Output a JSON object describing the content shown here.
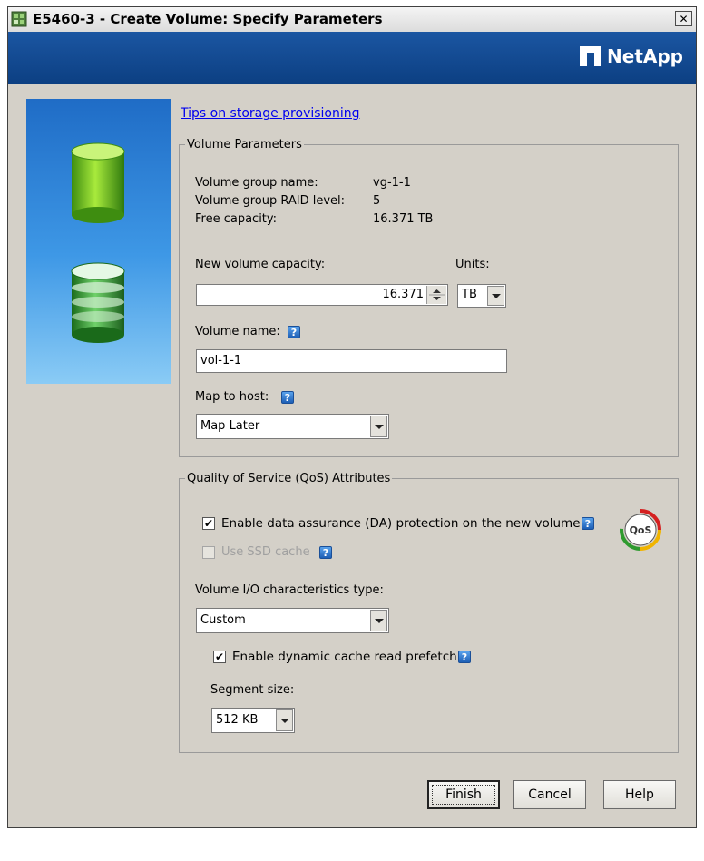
{
  "window": {
    "title": "E5460-3 - Create Volume: Specify Parameters",
    "close_glyph": "✕"
  },
  "banner": {
    "logo_text": "NetApp"
  },
  "tips_link": "Tips on storage provisioning",
  "volume_parameters": {
    "legend": "Volume Parameters",
    "group_name_label": "Volume group name:",
    "group_name_value": "vg-1-1",
    "raid_label": "Volume group RAID level:",
    "raid_value": "5",
    "free_label": "Free capacity:",
    "free_value": "16.371 TB",
    "capacity_label": "New volume capacity:",
    "capacity_value": "16.371",
    "units_label": "Units:",
    "units_value": "TB",
    "name_label": "Volume name:",
    "name_value": "vol-1-1",
    "map_label": "Map to host:",
    "map_value": "Map Later"
  },
  "qos": {
    "legend": "Quality of Service (QoS) Attributes",
    "da_label": "Enable data assurance (DA) protection on the new volume",
    "da_checked": true,
    "ssd_label": "Use SSD cache",
    "ssd_checked": false,
    "io_label": "Volume I/O characteristics type:",
    "io_value": "Custom",
    "prefetch_label": "Enable dynamic cache read prefetch",
    "prefetch_checked": true,
    "segment_label": "Segment size:",
    "segment_value": "512 KB",
    "badge_text": "QoS"
  },
  "help_glyph": "?",
  "check_glyph": "✔",
  "buttons": {
    "finish": "Finish",
    "cancel": "Cancel",
    "help": "Help"
  },
  "colors": {
    "banner": "#0c3f82",
    "dialog": "#d4d0c8",
    "link": "#0000ee"
  }
}
